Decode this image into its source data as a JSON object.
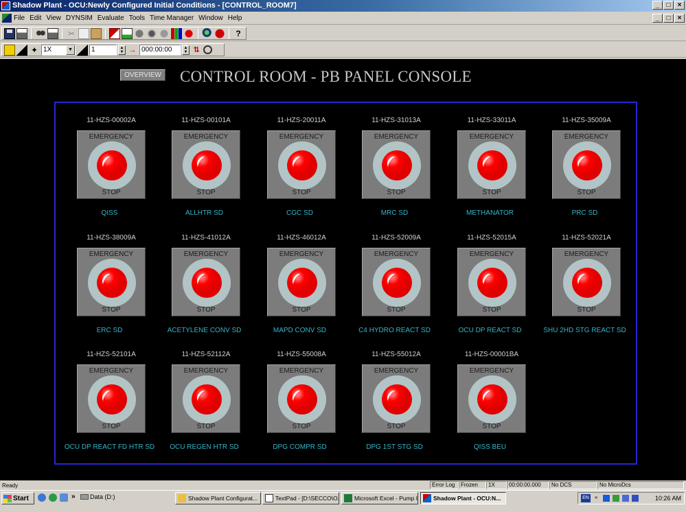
{
  "window": {
    "title": "Shadow Plant - OCU:Newly Configured Initial Conditions - [CONTROL_ROOM7]",
    "controls": [
      "_",
      "×"
    ]
  },
  "menu": [
    "File",
    "Edit",
    "View",
    "DYNSIM",
    "Evaluate",
    "Tools",
    "Time Manager",
    "Window",
    "Help"
  ],
  "toolbar2": {
    "speed": "1X",
    "step": "1",
    "time": "000:00:00"
  },
  "screen": {
    "overview_button": "OVERVIEW",
    "title": "CONTROL ROOM - PB PANEL CONSOLE",
    "button_top_text": "EMERGENCY",
    "button_bottom_text": "STOP"
  },
  "accent_colors": {
    "frame": "#2525d8",
    "label": "#35b5c8",
    "button_red": "#ff0000"
  },
  "stop_buttons": [
    {
      "tag": "11-HZS-00002A",
      "label": "QISS"
    },
    {
      "tag": "11-HZS-00101A",
      "label": "ALLHTR SD"
    },
    {
      "tag": "11-HZS-20011A",
      "label": "CGC SD"
    },
    {
      "tag": "11-HZS-31013A",
      "label": "MRC SD"
    },
    {
      "tag": "11-HZS-33011A",
      "label": "METHANATOR"
    },
    {
      "tag": "11-HZS-35009A",
      "label": "PRC SD"
    },
    {
      "tag": "11-HZS-38009A",
      "label": "ERC SD"
    },
    {
      "tag": "11-HZS-41012A",
      "label": "ACETYLENE CONV SD"
    },
    {
      "tag": "11-HZS-46012A",
      "label": "MAPD CONV SD"
    },
    {
      "tag": "11-HZS-52009A",
      "label": "C4 HYDRO REACT SD"
    },
    {
      "tag": "11-HZS-52015A",
      "label": "OCU DP REACT SD"
    },
    {
      "tag": "11-HZS-52021A",
      "label": "SHU 2HD STG REACT SD"
    },
    {
      "tag": "11-HZS-52101A",
      "label": "OCU DP REACT FD HTR SD"
    },
    {
      "tag": "11-HZS-52112A",
      "label": "OCU REGEN HTR SD"
    },
    {
      "tag": "11-HZS-55008A",
      "label": "DPG COMPR SD"
    },
    {
      "tag": "11-HZS-55012A",
      "label": "DPG 1ST STG SD"
    },
    {
      "tag": "11-HZS-00001BA",
      "label": "QISS BEU"
    }
  ],
  "statusbar": {
    "ready": "Ready",
    "error_log": "Error Log",
    "frozen": "Frozen",
    "speed": "1X",
    "time": "00:00:00.000",
    "dcs": "No DCS",
    "microdcs": "No MicroDcs"
  },
  "taskbar": {
    "start": "Start",
    "drive": "Data (D:)",
    "tasks": [
      "Shadow Plant Configurat...",
      "TextPad - [D:\\SECCO\\O...",
      "Microsoft Excel - Pump I...",
      "Shadow Plant - OCU:N..."
    ],
    "lang": "EN",
    "clock": "10:26 AM"
  }
}
